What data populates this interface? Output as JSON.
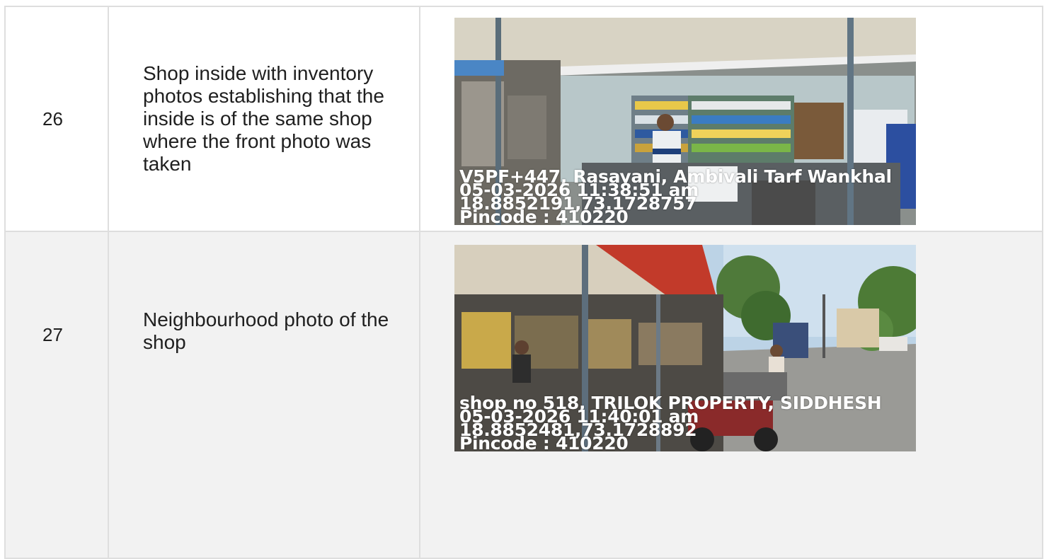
{
  "rows": [
    {
      "number": "26",
      "description": "Shop inside with inventory photos establishing that the inside is of the same shop where the front photo was taken",
      "photo": {
        "subject": "shop interior with shelves of inventory and shopkeeper at counter",
        "stamp": [
          "V5PF+447, Rasayani, Ambivali Tarf Wankhal",
          "05-03-2026 11:38:51 am",
          "18.8852191,73.1728757",
          "Pincode : 410220"
        ]
      }
    },
    {
      "number": "27",
      "description": "Neighbourhood photo of the shop",
      "photo": {
        "subject": "row of shops under a canopy beside a road with trees and parked motorbikes",
        "stamp": [
          "shop no 518, TRILOK PROPERTY, SIDDHESH",
          "05-03-2026 11:40:01 am",
          "18.8852481,73.1728892",
          "Pincode : 410220"
        ]
      }
    }
  ]
}
